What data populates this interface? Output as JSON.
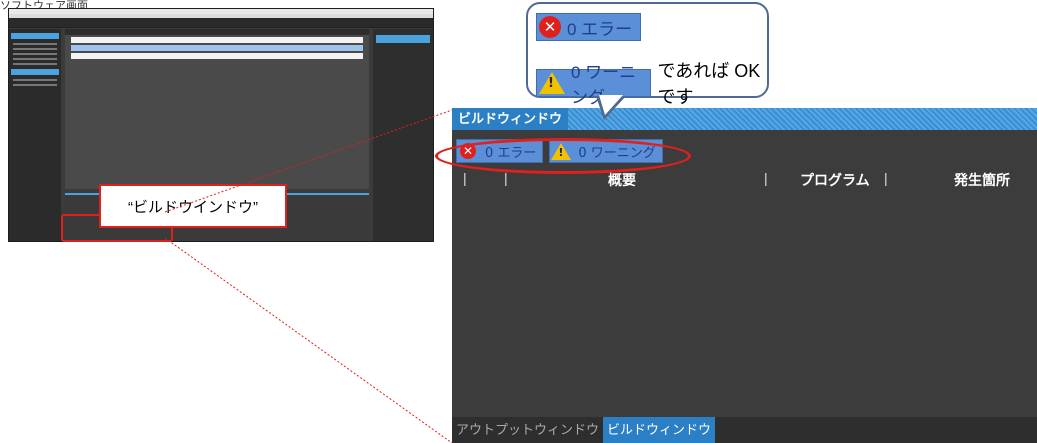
{
  "thumbnail": {
    "caption": "ソフトウェア画面",
    "callout_label": "“ビルドウインドウ”"
  },
  "bubble": {
    "error_badge": "0 エラー",
    "warning_badge": "0 ワーニング",
    "ok_text": "であれば OKです"
  },
  "build_window": {
    "title": "ビルドウィンドウ",
    "error_filter": "0 エラー",
    "warning_filter": "0 ワーニング",
    "columns": [
      "概要",
      "プログラム",
      "発生箇所"
    ],
    "tabs": {
      "output": "アウトプットウィンドウ",
      "build": "ビルドウィンドウ"
    }
  },
  "colors": {
    "highlight": "#e0201c",
    "accent": "#2a7fc5",
    "badge": "#5b8fd8"
  }
}
